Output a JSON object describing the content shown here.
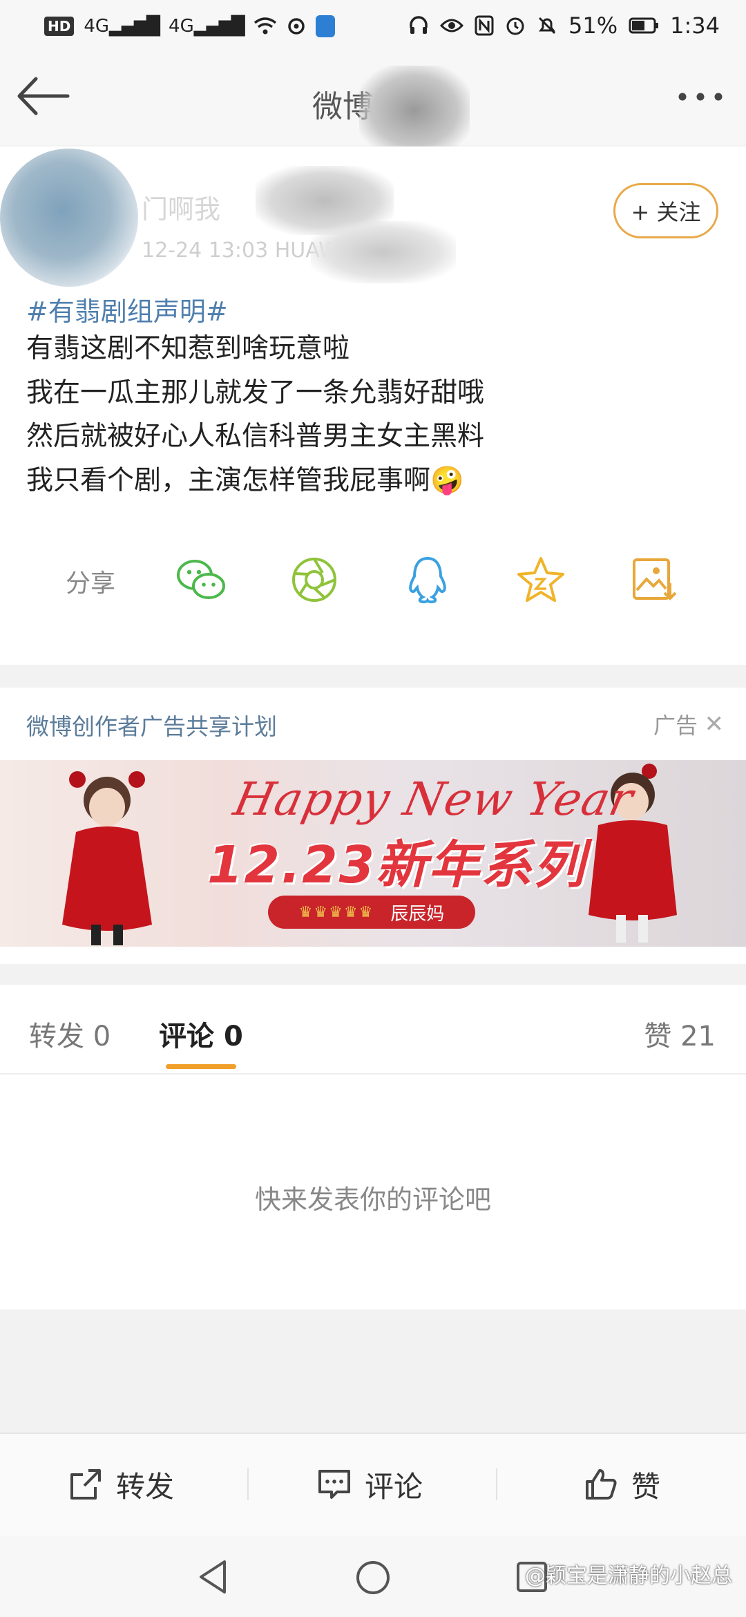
{
  "status_bar": {
    "left_badges": [
      "HD",
      "4G",
      "4G"
    ],
    "battery": "51%",
    "time": "1:34"
  },
  "nav": {
    "title": "微博正文",
    "back_icon": "arrow-left-icon",
    "more_icon": "more-dots-icon"
  },
  "post": {
    "username": "门啊我",
    "meta": "12-24 13:03   HUAWEI   0 Plus",
    "follow_label": "+ 关注",
    "hashtag": "#有翡剧组声明#",
    "lines": [
      "有翡这剧不知惹到啥玩意啦",
      "我在一瓜主那儿就发了一条允翡好甜哦",
      "然后就被好心人私信科普男主女主黑料",
      "我只看个剧，主演怎样管我屁事啊"
    ],
    "emoji": "🤪",
    "share_label": "分享",
    "share_icons": [
      "wechat-icon",
      "moments-icon",
      "qq-icon",
      "favorite-star-icon",
      "save-image-icon"
    ]
  },
  "ad": {
    "title": "微博创作者广告共享计划",
    "tag": "广告",
    "close": "✕",
    "banner": {
      "script": "Happy New Year",
      "headline": "12.23新年系列",
      "brand": "辰辰妈",
      "crowns": "♛♛♛♛♛"
    }
  },
  "tabs": [
    {
      "label": "转发",
      "count": "0"
    },
    {
      "label": "评论",
      "count": "0"
    },
    {
      "label": "赞",
      "count": "21"
    }
  ],
  "comments_empty": "快来发表你的评论吧",
  "actions": {
    "repost": "转发",
    "comment": "评论",
    "like": "赞"
  },
  "watermark": "@颖宝是潇静的小赵总",
  "colors": {
    "accent": "#f19f2b",
    "hashtag": "#4f7fae",
    "ad_title": "#5b7c9a",
    "banner_red": "#e3353d"
  }
}
